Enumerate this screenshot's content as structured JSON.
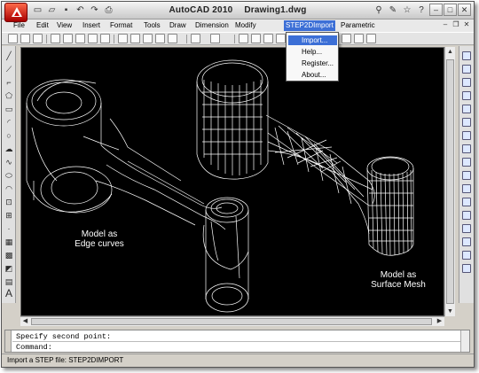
{
  "window": {
    "title": "AutoCAD 2010",
    "document": "Drawing1.dwg"
  },
  "menu": {
    "items": [
      "File",
      "Edit",
      "View",
      "Insert",
      "Format",
      "Tools",
      "Draw",
      "Dimension",
      "Modify",
      "STEP2DImport",
      "Parametric"
    ]
  },
  "dropdown": {
    "items": [
      "Import...",
      "Help...",
      "Register...",
      "About..."
    ]
  },
  "canvas": {
    "left_label_line1": "Model as",
    "left_label_line2": "Edge curves",
    "right_label_line1": "Model as",
    "right_label_line2": "Surface Mesh"
  },
  "command": {
    "history": "Specify second point:",
    "prompt": "Command:"
  },
  "status": {
    "text": "Import a STEP file: STEP2DIMPORT"
  },
  "colors": {
    "accent": "#3c6fd6",
    "canvas_bg": "#000000",
    "app_button": "#c81c00"
  }
}
